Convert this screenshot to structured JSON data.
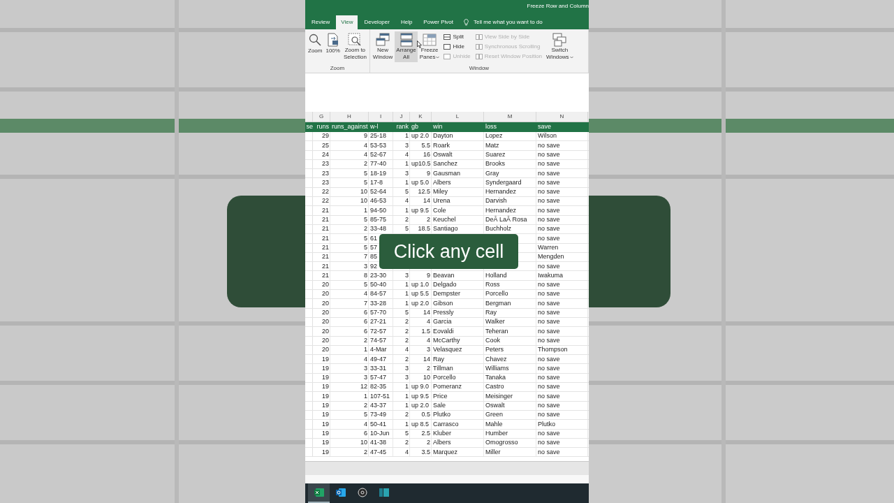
{
  "window": {
    "title": "Freeze Row and Column"
  },
  "tabs": [
    {
      "label": "Review",
      "selected": false
    },
    {
      "label": "View",
      "selected": true
    },
    {
      "label": "Developer",
      "selected": false
    },
    {
      "label": "Help",
      "selected": false
    },
    {
      "label": "Power Pivot",
      "selected": false
    }
  ],
  "tell_me": "Tell me what you want to do",
  "ribbon_groups": [
    {
      "label": "Zoom",
      "items": [
        {
          "kind": "large",
          "lines": [
            "Zoom"
          ],
          "dropdown": false,
          "hovered": false
        },
        {
          "kind": "large",
          "lines": [
            "100%"
          ],
          "dropdown": false,
          "hovered": false
        },
        {
          "kind": "large",
          "lines": [
            "Zoom to",
            "Selection"
          ],
          "dropdown": false,
          "hovered": false
        }
      ]
    },
    {
      "label": "Window",
      "items": [
        {
          "kind": "large",
          "lines": [
            "New",
            "Window"
          ],
          "dropdown": false,
          "hovered": false
        },
        {
          "kind": "large",
          "lines": [
            "Arrange",
            "All"
          ],
          "dropdown": false,
          "hovered": true
        },
        {
          "kind": "large",
          "lines": [
            "Freeze",
            "Panes"
          ],
          "dropdown": true,
          "hovered": false
        },
        {
          "kind": "stack",
          "buttons": [
            {
              "label": "Split",
              "disabled": false
            },
            {
              "label": "Hide",
              "disabled": false
            },
            {
              "label": "Unhide",
              "disabled": true
            }
          ]
        },
        {
          "kind": "stack",
          "buttons": [
            {
              "label": "View Side by Side",
              "disabled": true
            },
            {
              "label": "Synchronous Scrolling",
              "disabled": true
            },
            {
              "label": "Reset Window Position",
              "disabled": true
            }
          ]
        },
        {
          "kind": "large",
          "lines": [
            "Switch",
            "Windows"
          ],
          "dropdown": true,
          "hovered": false
        }
      ]
    }
  ],
  "sheet": {
    "column_letters": [
      "G",
      "H",
      "I",
      "J",
      "K",
      "L",
      "M",
      "N"
    ],
    "headers": [
      "se",
      "runs",
      "runs_against",
      "w-l",
      "rank",
      "gb",
      "win",
      "loss",
      "save"
    ],
    "rows": [
      [
        "29",
        "9",
        "25-18",
        "1",
        "up 2.0",
        "Dayton",
        "Lopez",
        "Wilson"
      ],
      [
        "25",
        "4",
        "53-53",
        "3",
        "5.5",
        "Roark",
        "Matz",
        "no save"
      ],
      [
        "24",
        "4",
        "52-67",
        "4",
        "16",
        "Oswalt",
        "Suarez",
        "no save"
      ],
      [
        "23",
        "2",
        "77-40",
        "1",
        "up10.5",
        "Sanchez",
        "Brooks",
        "no save"
      ],
      [
        "23",
        "5",
        "18-19",
        "3",
        "9",
        "Gausman",
        "Gray",
        "no save"
      ],
      [
        "23",
        "5",
        "17-8",
        "1",
        "up 5.0",
        "Albers",
        "Syndergaard",
        "no save"
      ],
      [
        "22",
        "10",
        "52-64",
        "5",
        "12.5",
        "Miley",
        "Hernandez",
        "no save"
      ],
      [
        "22",
        "10",
        "46-53",
        "4",
        "14",
        "Urena",
        "Darvish",
        "no save"
      ],
      [
        "21",
        "1",
        "94-50",
        "1",
        "up 9.5",
        "Cole",
        "Hernandez",
        "no save"
      ],
      [
        "21",
        "5",
        "85-75",
        "2",
        "2",
        "Keuchel",
        "DeÂ LaÂ Rosa",
        "no save"
      ],
      [
        "21",
        "2",
        "33-48",
        "5",
        "18.5",
        "Santiago",
        "Buchholz",
        "no save"
      ],
      [
        "21",
        "5",
        "61",
        null,
        null,
        null,
        null,
        "no save"
      ],
      [
        "21",
        "5",
        "57",
        null,
        null,
        null,
        null,
        "Warren"
      ],
      [
        "21",
        "7",
        "85",
        null,
        null,
        null,
        null,
        "Mengden"
      ],
      [
        "21",
        "3",
        "92",
        null,
        null,
        null,
        null,
        "no save"
      ],
      [
        "21",
        "8",
        "23-30",
        "3",
        "9",
        "Beavan",
        "Holland",
        "Iwakuma"
      ],
      [
        "20",
        "5",
        "50-40",
        "1",
        "up 1.0",
        "Delgado",
        "Ross",
        "no save"
      ],
      [
        "20",
        "4",
        "84-57",
        "1",
        "up 5.5",
        "Dempster",
        "Porcello",
        "no save"
      ],
      [
        "20",
        "7",
        "33-28",
        "1",
        "up 2.0",
        "Gibson",
        "Bergman",
        "no save"
      ],
      [
        "20",
        "6",
        "57-70",
        "5",
        "14",
        "Pressly",
        "Ray",
        "no save"
      ],
      [
        "20",
        "6",
        "27-21",
        "2",
        "4",
        "Garcia",
        "Walker",
        "no save"
      ],
      [
        "20",
        "6",
        "72-57",
        "2",
        "1.5",
        "Eovaldi",
        "Teheran",
        "no save"
      ],
      [
        "20",
        "2",
        "74-57",
        "2",
        "4",
        "McCarthy",
        "Cook",
        "no save"
      ],
      [
        "20",
        "1",
        "4-Mar",
        "4",
        "3",
        "Velasquez",
        "Peters",
        "Thompson"
      ],
      [
        "19",
        "4",
        "49-47",
        "2",
        "14",
        "Ray",
        "Chavez",
        "no save"
      ],
      [
        "19",
        "3",
        "33-31",
        "3",
        "2",
        "Tillman",
        "Williams",
        "no save"
      ],
      [
        "19",
        "3",
        "57-47",
        "3",
        "10",
        "Porcello",
        "Tanaka",
        "no save"
      ],
      [
        "19",
        "12",
        "82-35",
        "1",
        "up 9.0",
        "Pomeranz",
        "Castro",
        "no save"
      ],
      [
        "19",
        "1",
        "107-51",
        "1",
        "up 9.5",
        "Price",
        "Meisinger",
        "no save"
      ],
      [
        "19",
        "2",
        "43-37",
        "1",
        "up 2.0",
        "Sale",
        "Oswalt",
        "no save"
      ],
      [
        "19",
        "5",
        "73-49",
        "2",
        "0.5",
        "Plutko",
        "Green",
        "no save"
      ],
      [
        "19",
        "4",
        "50-41",
        "1",
        "up 8.5",
        "Carrasco",
        "Mahle",
        "Plutko"
      ],
      [
        "19",
        "6",
        "10-Jun",
        "5",
        "2.5",
        "Kluber",
        "Humber",
        "no save"
      ],
      [
        "19",
        "10",
        "41-38",
        "2",
        "2",
        "Albers",
        "Omogrosso",
        "no save"
      ],
      [
        "19",
        "2",
        "47-45",
        "4",
        "3.5",
        "Marquez",
        "Miller",
        "no save"
      ]
    ]
  },
  "caption": "Click any cell",
  "taskbar": [
    {
      "selected": true
    },
    {
      "selected": false
    },
    {
      "selected": false
    },
    {
      "selected": false
    }
  ]
}
